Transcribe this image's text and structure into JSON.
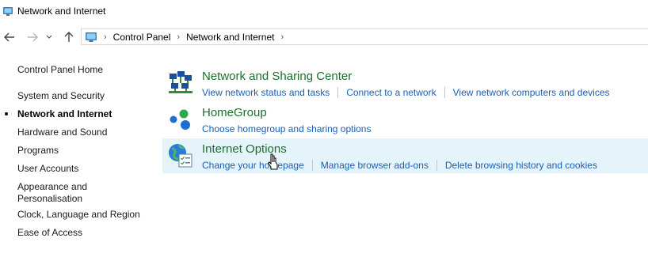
{
  "window": {
    "title": "Network and Internet",
    "icon": "control-panel-icon"
  },
  "navigation": {
    "back_icon": "back-arrow-icon",
    "forward_icon": "forward-arrow-icon",
    "recent_icon": "chevron-down-icon",
    "up_icon": "up-arrow-icon"
  },
  "address": {
    "icon": "control-panel-icon",
    "crumbs": [
      "Control Panel",
      "Network and Internet"
    ],
    "separator": "›"
  },
  "sidebar": {
    "home": "Control Panel Home",
    "items": [
      {
        "label": "System and Security",
        "active": false
      },
      {
        "label": "Network and Internet",
        "active": true
      },
      {
        "label": "Hardware and Sound",
        "active": false
      },
      {
        "label": "Programs",
        "active": false
      },
      {
        "label": "User Accounts",
        "active": false
      },
      {
        "label": "Appearance and",
        "active": false
      },
      {
        "label": "Personalisation",
        "active": false
      },
      {
        "label": "Clock, Language and Region",
        "active": false
      },
      {
        "label": "Ease of Access",
        "active": false
      }
    ]
  },
  "categories": [
    {
      "title": "Network and Sharing Center",
      "icon": "network-sharing-icon",
      "links": [
        "View network status and tasks",
        "Connect to a network",
        "View network computers and devices"
      ]
    },
    {
      "title": "HomeGroup",
      "icon": "homegroup-icon",
      "links": [
        "Choose homegroup and sharing options"
      ]
    },
    {
      "title": "Internet Options",
      "icon": "internet-options-icon",
      "links": [
        "Change your homepage",
        "Manage browser add-ons",
        "Delete browsing history and cookies"
      ],
      "hovered": true
    }
  ],
  "colors": {
    "link": "#1a5fb4",
    "category_title": "#1e6e2e",
    "hover_bg": "#e5f3fb"
  }
}
